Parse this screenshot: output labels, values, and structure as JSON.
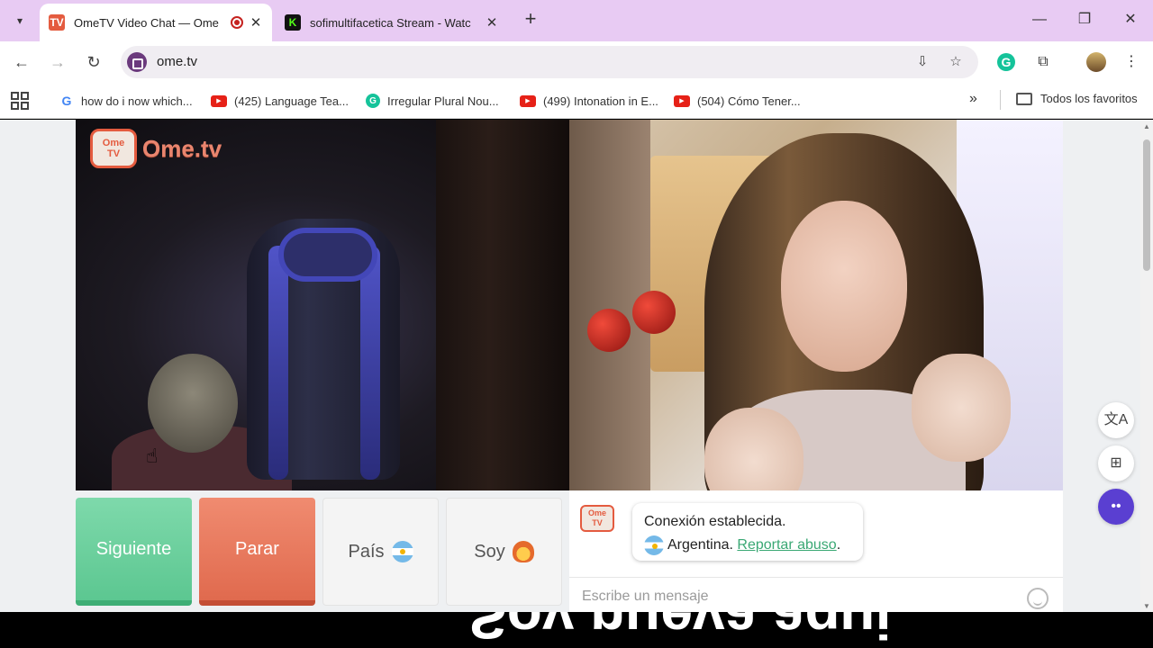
{
  "tabs": [
    {
      "title": "OmeTV Video Chat — Ome",
      "favicon": "ometv-icon",
      "recording": true
    },
    {
      "title": "sofimultifacetica Stream - Watc",
      "favicon": "kick-icon"
    }
  ],
  "toolbar": {
    "url": "ome.tv"
  },
  "bookmarks": {
    "items": [
      {
        "label": "how do i now which...",
        "icon": "google-icon"
      },
      {
        "label": "(425) Language Tea...",
        "icon": "youtube-icon"
      },
      {
        "label": "Irregular Plural Nou...",
        "icon": "grammarly-icon"
      },
      {
        "label": "(499) Intonation in E...",
        "icon": "youtube-icon"
      },
      {
        "label": "(504) Cómo Tener...",
        "icon": "youtube-icon"
      }
    ],
    "all_bookmarks": "Todos los favoritos"
  },
  "page": {
    "logo": {
      "tv_top": "Ome",
      "tv_bottom": "TV",
      "text": "Ome.tv"
    },
    "buttons": {
      "next": "Siguiente",
      "stop": "Parar",
      "country": "País",
      "soy": "Soy"
    },
    "chat": {
      "status": "Conexión establecida.",
      "country": "Argentina.",
      "report": "Reportar abuso",
      "period": ".",
      "input_placeholder": "Escribe un mensaje"
    }
  },
  "subtitle_text": "Soy nueva aqui",
  "colors": {
    "next": "#5cc791",
    "stop": "#e06a4e",
    "accent_link": "#3aa874",
    "tab_strip": "#e8cbf3"
  }
}
